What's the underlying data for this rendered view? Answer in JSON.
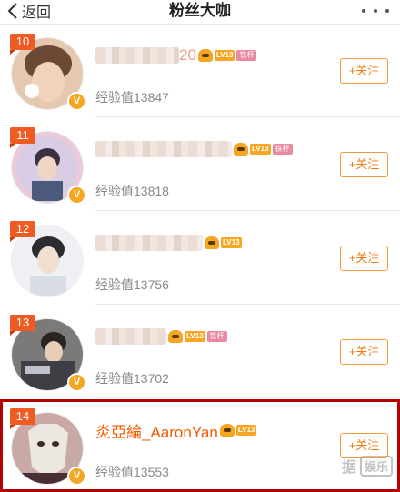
{
  "header": {
    "back_label": "返回",
    "title": "粉丝大咖"
  },
  "rows": [
    {
      "rank": "10",
      "name_suffix": "20",
      "level": "LV13",
      "vip": "铁杆",
      "exp": "经验值13847",
      "follow_label": "+关注"
    },
    {
      "rank": "11",
      "name_suffix": "",
      "level": "LV13",
      "vip": "铁杆",
      "exp": "经验值13818",
      "follow_label": "+关注"
    },
    {
      "rank": "12",
      "name_suffix": "",
      "level": "LV13",
      "exp": "经验值13756",
      "follow_label": "+关注"
    },
    {
      "rank": "13",
      "name_suffix": "",
      "level": "LV13",
      "vip": "铁杆",
      "exp": "经验值13702",
      "follow_label": "+关注"
    },
    {
      "rank": "14",
      "name": "炎亞綸_AaronYan",
      "level": "LV13",
      "exp": "经验值13553",
      "follow_label": "+关注"
    }
  ],
  "watermark": {
    "text": "据",
    "box_text": "娱乐"
  }
}
